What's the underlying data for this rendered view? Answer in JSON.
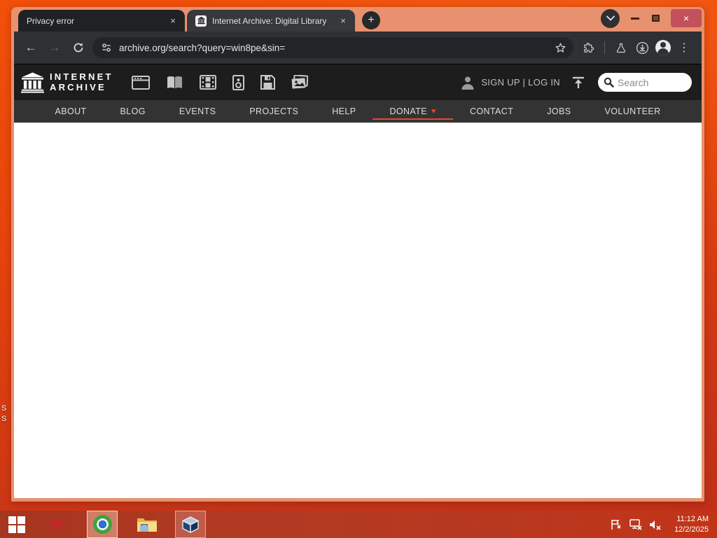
{
  "desktop": {
    "icon_fragments": [
      "S",
      "S"
    ]
  },
  "browser": {
    "tabs": [
      {
        "title": "Privacy error",
        "close_label": "×"
      },
      {
        "title": "Internet Archive: Digital Library",
        "close_label": "×"
      }
    ],
    "newtab_label": "+",
    "window_controls": {
      "close_label": "×"
    },
    "toolbar": {
      "back_icon": "←",
      "forward_icon": "→",
      "url": "archive.org/search?query=win8pe&sin=",
      "menu_icon": "⋮"
    }
  },
  "ia": {
    "wordmark_line1": "INTERNET",
    "wordmark_line2": "ARCHIVE",
    "media_icons": [
      "web",
      "texts",
      "video",
      "audio",
      "software",
      "images"
    ],
    "auth_text": "SIGN UP | LOG IN",
    "search_placeholder": "Search",
    "nav": [
      "ABOUT",
      "BLOG",
      "EVENTS",
      "PROJECTS",
      "HELP",
      "DONATE",
      "CONTACT",
      "JOBS",
      "VOLUNTEER"
    ],
    "donate_heart": "♥"
  },
  "taskbar": {
    "time": "11:12 AM",
    "date": "12/2/2025"
  },
  "colors": {
    "wallpaper_orange": "#e8450c",
    "window_frame_salmon": "#e8916e",
    "taskbar_red": "#b23a22",
    "close_button_red": "#c4505c",
    "donate_heart_red": "#ee4433",
    "ia_header_dark": "#1d1d1d",
    "ia_nav_gray": "#333333"
  }
}
